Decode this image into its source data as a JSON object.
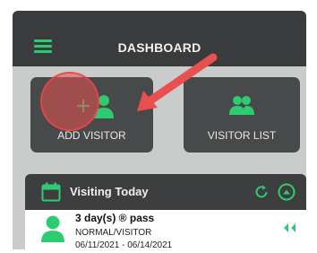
{
  "header": {
    "title": "DASHBOARD"
  },
  "tiles": [
    {
      "label": "ADD VISITOR",
      "icon": "add-user-icon"
    },
    {
      "label": "VISITOR LIST",
      "icon": "users-icon"
    }
  ],
  "section": {
    "title": "Visiting Today"
  },
  "visit": {
    "title": "3 day(s) ® pass",
    "type": "NORMAL/VISITOR",
    "dates": "06/11/2021 - 06/14/2021"
  },
  "colors": {
    "accent": "#2ecc71",
    "header": "#3a3b3c",
    "tile": "#48494a",
    "background": "#c9ccca",
    "annotation": "#e8504f"
  }
}
